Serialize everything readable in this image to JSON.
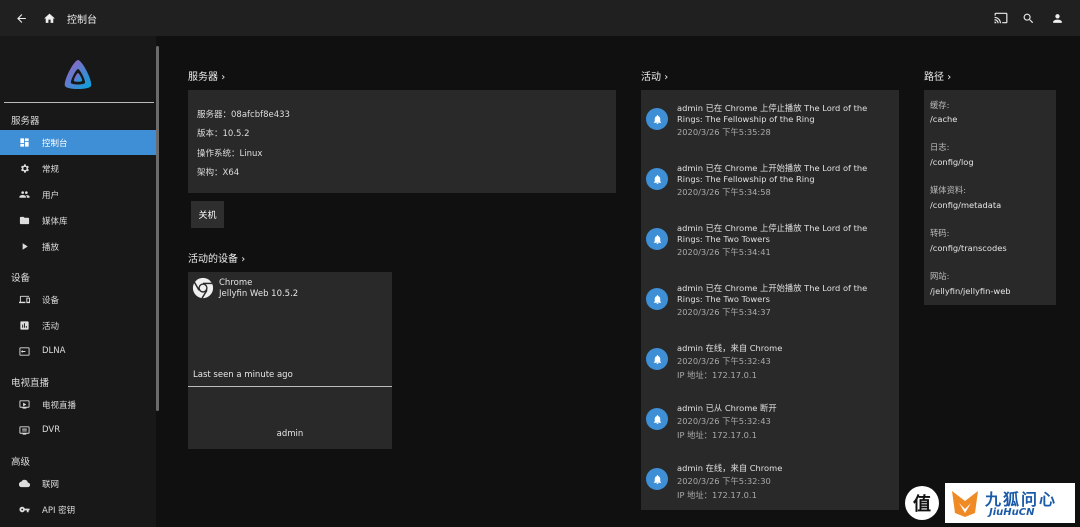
{
  "topbar": {
    "title": "控制台"
  },
  "sidebar": {
    "sections": [
      {
        "head": "服务器",
        "items": [
          {
            "label": "控制台",
            "icon": "dashboard-icon",
            "active": true
          },
          {
            "label": "常规",
            "icon": "gear-icon"
          },
          {
            "label": "用户",
            "icon": "users-icon"
          },
          {
            "label": "媒体库",
            "icon": "folder-icon"
          },
          {
            "label": "播放",
            "icon": "play-icon"
          }
        ]
      },
      {
        "head": "设备",
        "items": [
          {
            "label": "设备",
            "icon": "devices-icon"
          },
          {
            "label": "活动",
            "icon": "activity-icon"
          },
          {
            "label": "DLNA",
            "icon": "dlna-icon"
          }
        ]
      },
      {
        "head": "电视直播",
        "items": [
          {
            "label": "电视直播",
            "icon": "live-tv-icon"
          },
          {
            "label": "DVR",
            "icon": "dvr-icon"
          }
        ]
      },
      {
        "head": "高级",
        "items": [
          {
            "label": "联网",
            "icon": "cloud-icon"
          },
          {
            "label": "API 密钥",
            "icon": "key-icon"
          }
        ]
      }
    ]
  },
  "server": {
    "title": "服务器",
    "lines": [
      "服务器：08afcbf8e433",
      "版本：10.5.2",
      "操作系统：Linux",
      "架构：X64"
    ],
    "shutdown_label": "关机"
  },
  "devices": {
    "title": "活动的设备",
    "app": "Chrome",
    "client": "Jellyfin Web 10.5.2",
    "last_seen": "Last seen a minute ago",
    "user": "admin"
  },
  "activity": {
    "title": "活动",
    "items": [
      {
        "text": "admin 已在 Chrome 上停止播放 The Lord of the Rings: The Fellowship of the Ring",
        "date": "2020/3/26 下午5:35:28"
      },
      {
        "text": "admin 已在 Chrome 上开始播放 The Lord of the Rings: The Fellowship of the Ring",
        "date": "2020/3/26 下午5:34:58"
      },
      {
        "text": "admin 已在 Chrome 上停止播放 The Lord of the Rings: The Two Towers",
        "date": "2020/3/26 下午5:34:41"
      },
      {
        "text": "admin 已在 Chrome 上开始播放 The Lord of the Rings: The Two Towers",
        "date": "2020/3/26 下午5:34:37"
      },
      {
        "text": "admin 在线，来自 Chrome",
        "date": "2020/3/26 下午5:32:43",
        "sub": "IP 地址：172.17.0.1"
      },
      {
        "text": "admin 已从 Chrome 断开",
        "date": "2020/3/26 下午5:32:43",
        "sub": "IP 地址：172.17.0.1"
      },
      {
        "text": "admin 在线，来自 Chrome",
        "date": "2020/3/26 下午5:32:30",
        "sub": "IP 地址：172.17.0.1"
      }
    ]
  },
  "paths": {
    "title": "路径",
    "items": [
      {
        "label": "缓存:",
        "value": "/cache"
      },
      {
        "label": "日志:",
        "value": "/config/log"
      },
      {
        "label": "媒体资料:",
        "value": "/config/metadata"
      },
      {
        "label": "转码:",
        "value": "/config/transcodes"
      },
      {
        "label": "网站:",
        "value": "/jellyfin/jellyfin-web"
      }
    ]
  },
  "watermark": {
    "badge": "值",
    "main": "九狐问心",
    "sub": "JiuHuCN"
  },
  "colors": {
    "accent": "#3f8fd6",
    "panel": "#292929",
    "background": "#101010"
  }
}
